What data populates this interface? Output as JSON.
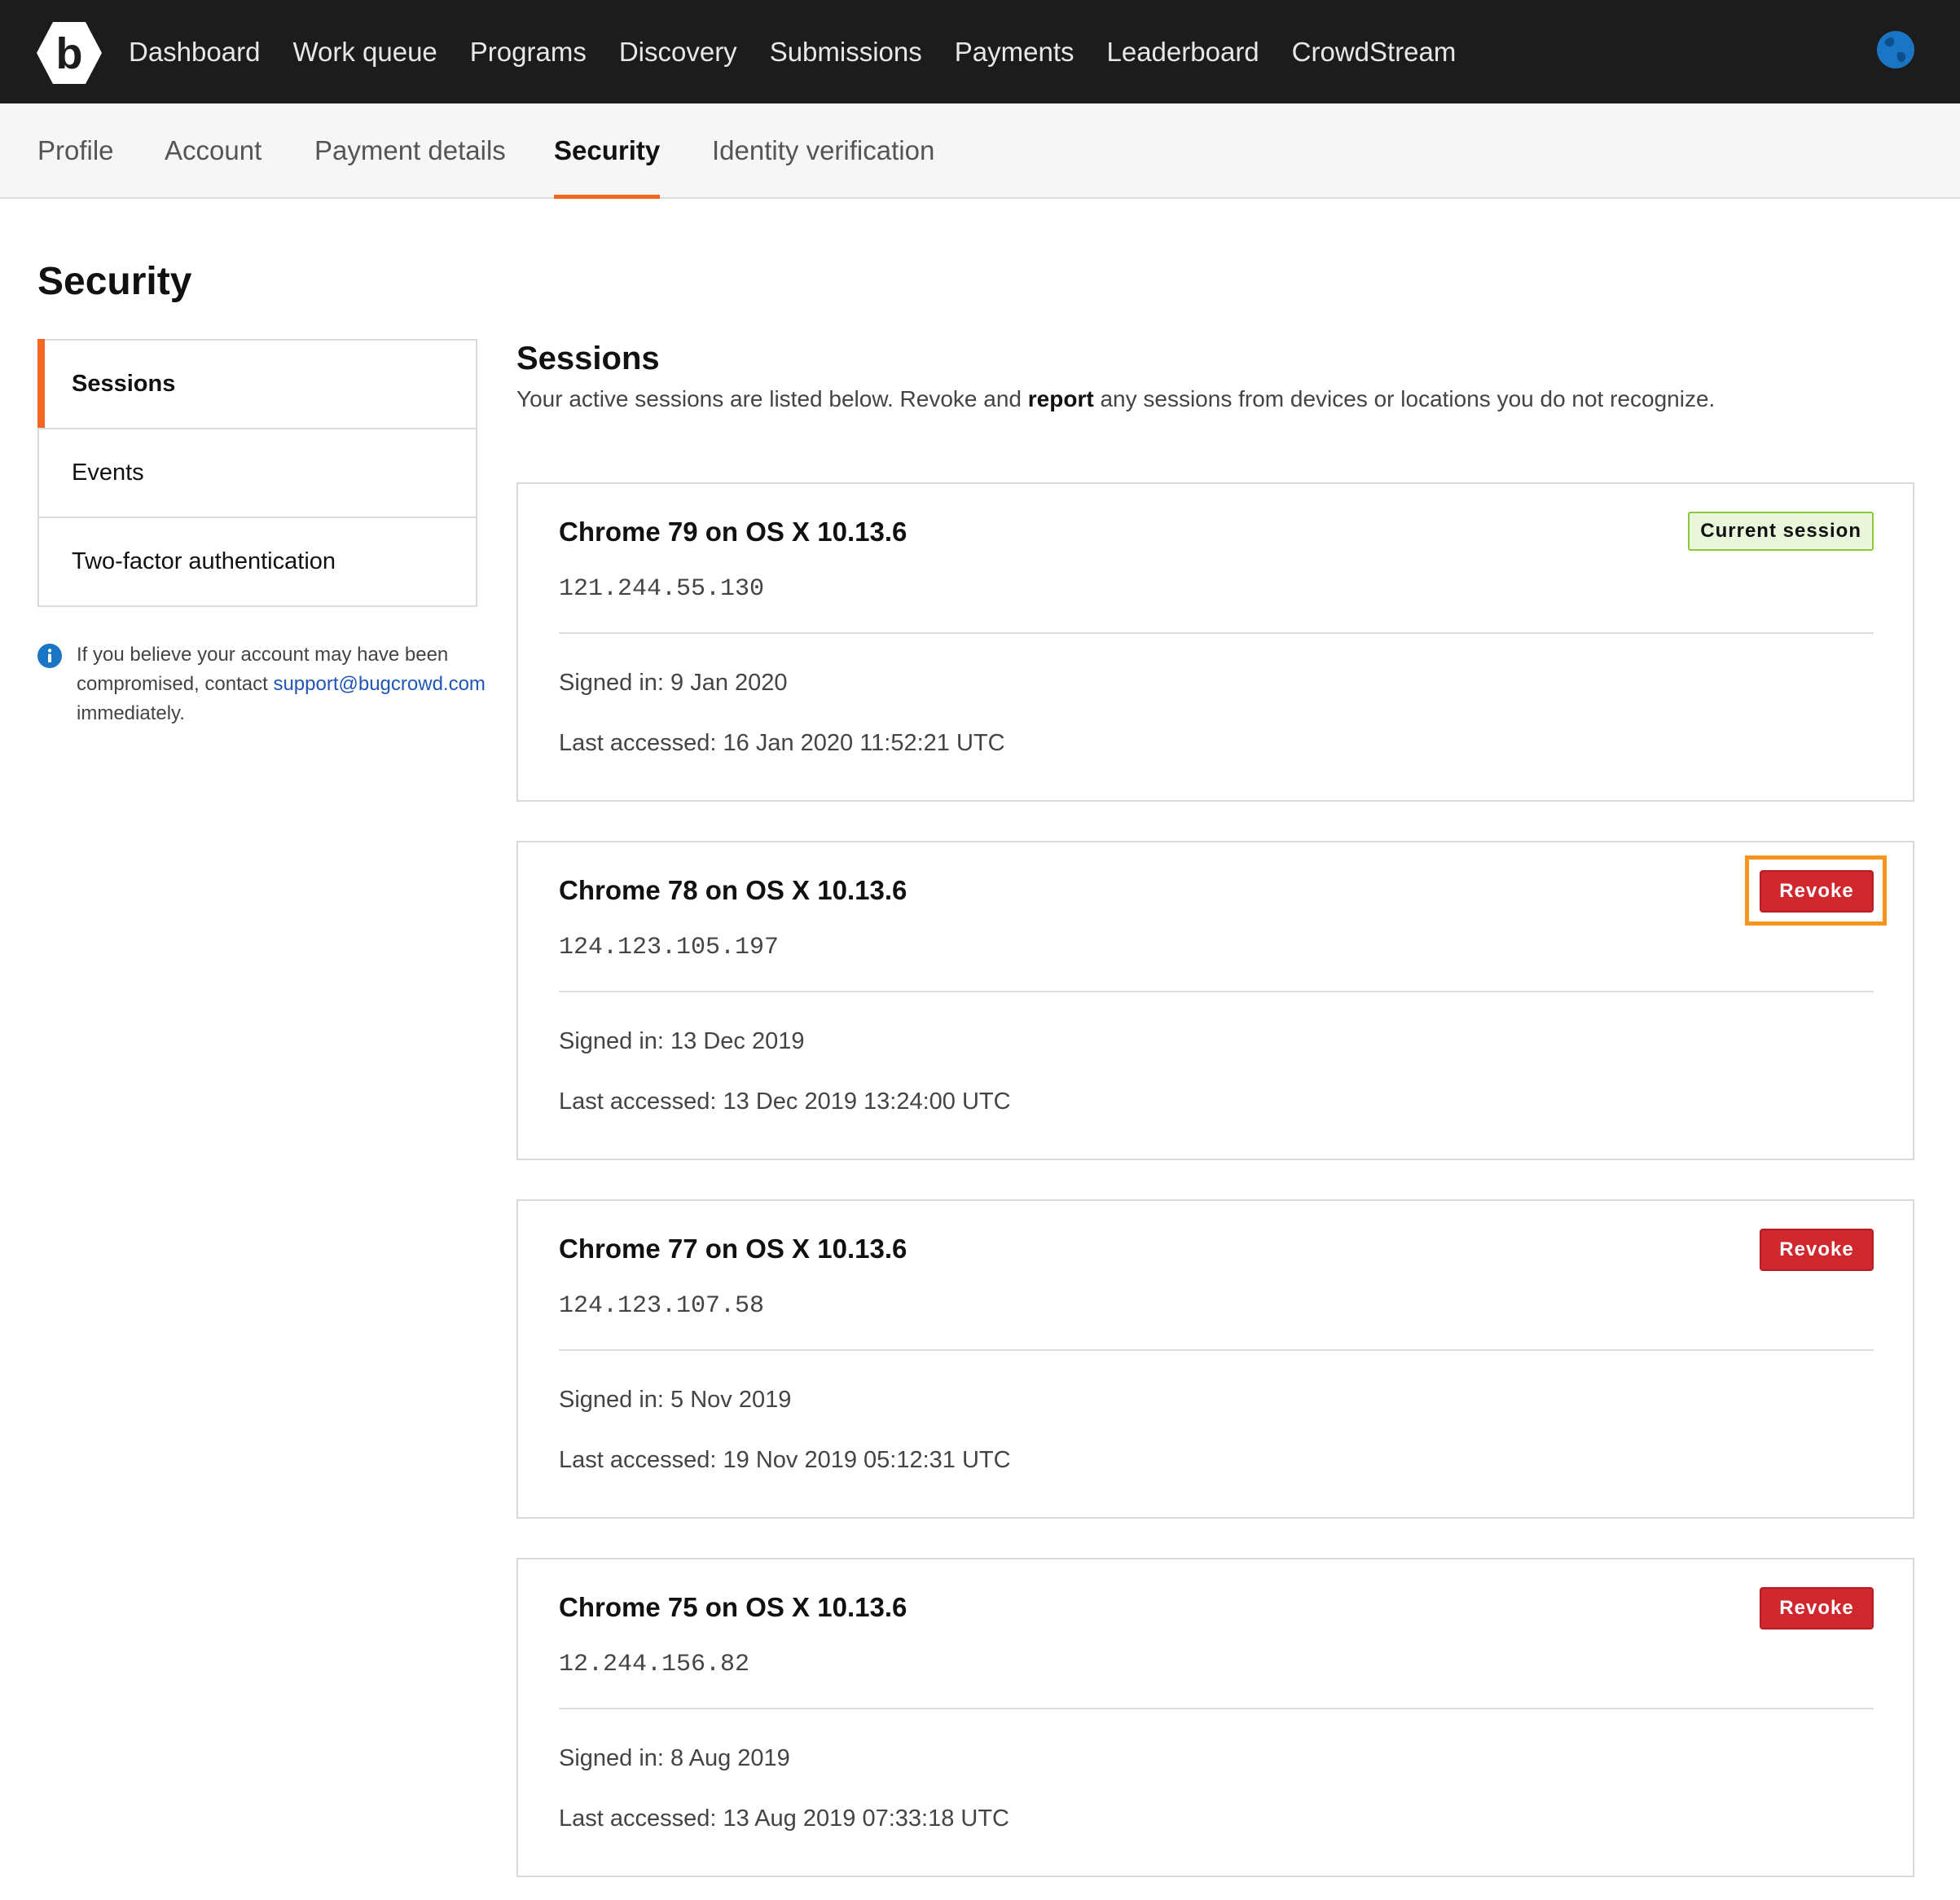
{
  "topnav": {
    "logo_letter": "b",
    "links": [
      "Dashboard",
      "Work queue",
      "Programs",
      "Discovery",
      "Submissions",
      "Payments",
      "Leaderboard",
      "CrowdStream"
    ]
  },
  "subnav": {
    "tabs": [
      "Profile",
      "Account",
      "Payment details",
      "Security",
      "Identity verification"
    ],
    "active": "Security"
  },
  "page": {
    "title": "Security"
  },
  "sidemenu": {
    "items": [
      "Sessions",
      "Events",
      "Two-factor authentication"
    ],
    "active": "Sessions"
  },
  "info": {
    "text_before": "If you believe your account may have been compromised, contact ",
    "link": "support@bugcrowd.com",
    "text_after": " immediately."
  },
  "sessions": {
    "title": "Sessions",
    "desc_before": "Your active sessions are listed below. Revoke and ",
    "desc_bold": "report",
    "desc_after": " any sessions from devices or locations you do not recognize.",
    "current_label": "Current session",
    "revoke_label": "Revoke",
    "items": [
      {
        "title": "Chrome 79 on OS X 10.13.6",
        "ip": "121.244.55.130",
        "signed_in": "Signed in: 9 Jan 2020",
        "last_accessed": "Last accessed: 16 Jan 2020 11:52:21 UTC",
        "current": true
      },
      {
        "title": "Chrome 78 on OS X 10.13.6",
        "ip": "124.123.105.197",
        "signed_in": "Signed in: 13 Dec 2019",
        "last_accessed": "Last accessed: 13 Dec 2019 13:24:00 UTC",
        "current": false
      },
      {
        "title": "Chrome 77 on OS X 10.13.6",
        "ip": "124.123.107.58",
        "signed_in": "Signed in: 5 Nov 2019",
        "last_accessed": "Last accessed: 19 Nov 2019 05:12:31 UTC",
        "current": false
      },
      {
        "title": "Chrome 75 on OS X 10.13.6",
        "ip": "12.244.156.82",
        "signed_in": "Signed in: 8 Aug 2019",
        "last_accessed": "Last accessed: 13 Aug 2019 07:33:18 UTC",
        "current": false
      }
    ]
  },
  "colors": {
    "accent": "#f26822",
    "nav_bg": "#1c1c1c",
    "revoke": "#d0272f",
    "current_badge_bg": "#eaf6d9",
    "current_badge_border": "#8cc63f",
    "link": "#1f56b8",
    "highlight": "#f7941d"
  }
}
